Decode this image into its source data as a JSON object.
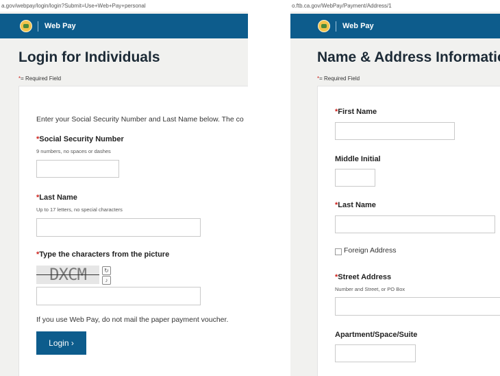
{
  "left_window": {
    "url": "a.gov/webpay/login/login?Submit=Use+Web+Pay+personal",
    "app_name": "Web Pay",
    "page_title": "Login for Individuals",
    "required_note": "= Required Field",
    "intro_text": "Enter your Social Security Number and Last Name below. The co",
    "ssn": {
      "label": "Social Security Number",
      "hint": "9 numbers, no spaces or dashes",
      "value": ""
    },
    "last_name": {
      "label": "Last Name",
      "hint": "Up to 17 letters, no special characters",
      "value": ""
    },
    "captcha": {
      "label": "Type the characters from the picture",
      "image_text": "DXCM",
      "value": ""
    },
    "notice": "If you use Web Pay, do not mail the paper payment voucher.",
    "login_button": "Login",
    "login_chevron": "›"
  },
  "right_window": {
    "url": "o.ftb.ca.gov/WebPay/Payment/Address/1",
    "app_name": "Web Pay",
    "page_title": "Name & Address Information",
    "required_note": "= Required Field",
    "first_name": {
      "label": "First Name",
      "value": ""
    },
    "middle_initial": {
      "label": "Middle Initial",
      "value": ""
    },
    "last_name": {
      "label": "Last Name",
      "value": ""
    },
    "foreign_address": {
      "label": "Foreign Address",
      "checked": false
    },
    "street_address": {
      "label": "Street Address",
      "hint": "Number and Street, or PO Box",
      "value": ""
    },
    "apartment": {
      "label": "Apartment/Space/Suite",
      "value": ""
    }
  },
  "colors": {
    "header_blue": "#0d5c8c",
    "required_red": "#cc1f1a",
    "page_bg": "#f1f1ef",
    "logo_gold": "#f3c34c"
  },
  "icons": {
    "logo": "ftb-seal-icon",
    "captcha_refresh": "refresh-icon",
    "captcha_audio": "audio-icon"
  }
}
